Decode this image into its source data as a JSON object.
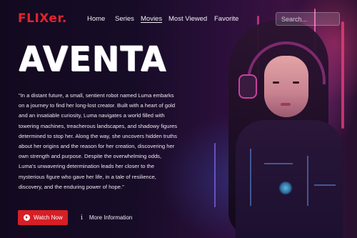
{
  "brand": {
    "logo": "FLIXer."
  },
  "nav": {
    "links": [
      {
        "label": "Home",
        "active": false
      },
      {
        "label": "Series",
        "active": false
      },
      {
        "label": "Movies",
        "active": true
      },
      {
        "label": "Most Viewed",
        "active": false
      },
      {
        "label": "Favorite",
        "active": false
      }
    ]
  },
  "search": {
    "placeholder": "Search..."
  },
  "hero": {
    "title": "AVENTA",
    "description": "\"In a distant future, a small, sentient robot named Luma embarks on a journey to find her long-lost creator. Built with a heart of gold and an insatiable curiosity, Luma navigates a world filled with towering machines, treacherous landscapes, and shadowy figures determined to stop her. Along the way, she uncovers hidden truths about her origins and the reason for her creation, discovering her own strength and purpose. Despite the overwhelming odds, Luma's unwavering determination leads her closer to the mysterious figure who gave her life, in a tale of resilience, discovery, and the enduring power of hope.\"",
    "watch_label": "Watch Now",
    "info_label": "More Information",
    "watch_icon": "play-circle-icon",
    "info_icon": "info-icon"
  },
  "colors": {
    "accent": "#d61f26",
    "background": "#140a22",
    "text": "#ffffff"
  }
}
